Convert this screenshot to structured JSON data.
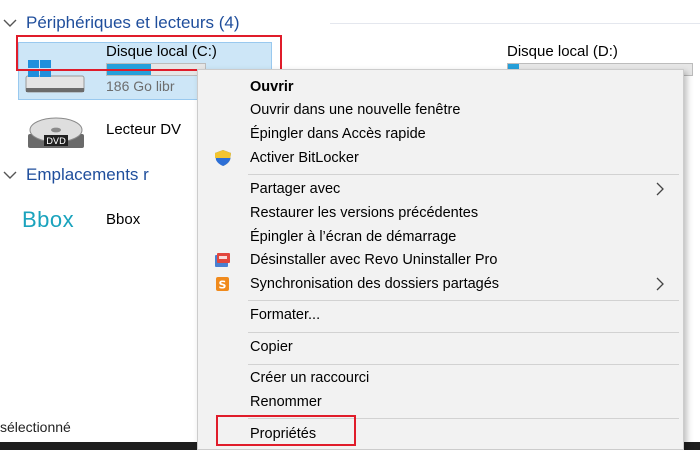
{
  "explorer": {
    "devices_section_title": "Périphériques et lecteurs (4)",
    "locations_section_title": "Emplacements r",
    "drives": [
      {
        "name": "Disque local (C:)",
        "subtitle": "186 Go libr",
        "usage_fraction": 0.45,
        "selected": true
      },
      {
        "name": "Disque local (D:)",
        "subtitle": "",
        "usage_fraction": 0.06,
        "selected": false
      },
      {
        "name": "Lecteur DV",
        "icon_label": "DVD"
      }
    ],
    "network_location": {
      "name": "Bbox",
      "logo_text": "Bbox"
    },
    "status_bar_text": "sélectionné"
  },
  "context_menu": {
    "items": [
      {
        "label": "Ouvrir",
        "bold": true
      },
      {
        "label": "Ouvrir dans une nouvelle fenêtre"
      },
      {
        "label": "Épingler dans Accès rapide"
      },
      {
        "label": "Activer BitLocker",
        "icon": "shield-icon"
      },
      {
        "label": "Partager avec",
        "submenu": true
      },
      {
        "label": "Restaurer les versions précédentes"
      },
      {
        "label": "Épingler à l’écran de démarrage"
      },
      {
        "label": "Désinstaller avec Revo Uninstaller Pro",
        "icon": "revo-uninstaller-icon"
      },
      {
        "label": "Synchronisation des dossiers partagés",
        "icon": "sync-folders-icon",
        "submenu": true
      },
      {
        "label": "Formater..."
      },
      {
        "label": "Copier"
      },
      {
        "label": "Créer un raccourci"
      },
      {
        "label": "Renommer"
      },
      {
        "label": "Propriétés"
      }
    ]
  },
  "colors": {
    "section_title": "#1f4e9c",
    "selection_bg": "#cde6f7",
    "usage_fill": "#26a0da",
    "highlight": "#e01c2a",
    "bbox_logo": "#1aa3bd",
    "menu_bg": "#f2f2f2"
  }
}
